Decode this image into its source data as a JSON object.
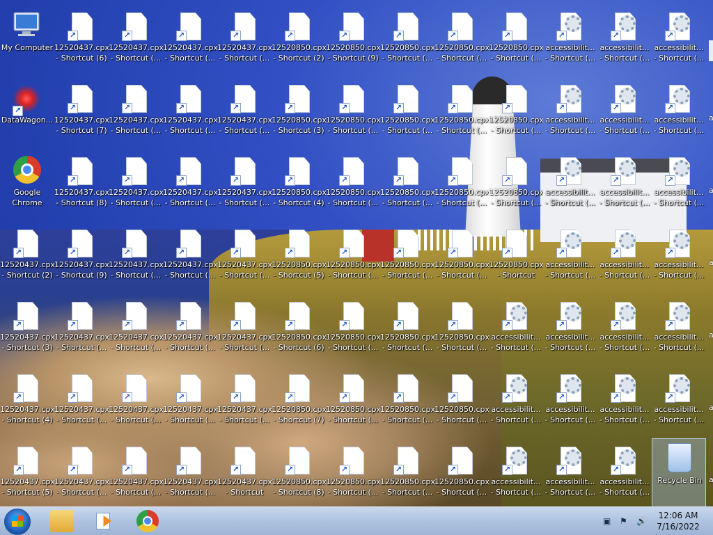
{
  "desktop": {
    "columns": [
      {
        "items": [
          {
            "kind": "computer",
            "l1": "My Computer",
            "l2": ""
          },
          {
            "kind": "datawagon",
            "l1": "DataWagon...",
            "l2": ""
          },
          {
            "kind": "chrome",
            "l1": "Google",
            "l2": "Chrome"
          },
          {
            "kind": "doc",
            "l1": "12520437.cpx",
            "l2": "- Shortcut (2)"
          },
          {
            "kind": "doc",
            "l1": "12520437.cpx",
            "l2": "- Shortcut (3)"
          },
          {
            "kind": "doc",
            "l1": "12520437.cpx",
            "l2": "- Shortcut (4)"
          },
          {
            "kind": "doc",
            "l1": "12520437.cpx",
            "l2": "- Shortcut (5)"
          }
        ]
      },
      {
        "items": [
          {
            "kind": "doc",
            "l1": "12520437.cpx",
            "l2": "- Shortcut (6)"
          },
          {
            "kind": "doc",
            "l1": "12520437.cpx",
            "l2": "- Shortcut (7)"
          },
          {
            "kind": "doc",
            "l1": "12520437.cpx",
            "l2": "- Shortcut (8)"
          },
          {
            "kind": "doc",
            "l1": "12520437.cpx",
            "l2": "- Shortcut (9)"
          },
          {
            "kind": "doc",
            "l1": "12520437.cpx",
            "l2": "- Shortcut (..."
          },
          {
            "kind": "doc",
            "l1": "12520437.cpx",
            "l2": "- Shortcut (..."
          },
          {
            "kind": "doc",
            "l1": "12520437.cpx",
            "l2": "- Shortcut (..."
          }
        ]
      },
      {
        "items": [
          {
            "kind": "doc",
            "l1": "12520437.cpx",
            "l2": "- Shortcut (..."
          },
          {
            "kind": "doc",
            "l1": "12520437.cpx",
            "l2": "- Shortcut (..."
          },
          {
            "kind": "doc",
            "l1": "12520437.cpx",
            "l2": "- Shortcut (..."
          },
          {
            "kind": "doc",
            "l1": "12520437.cpx",
            "l2": "- Shortcut (..."
          },
          {
            "kind": "doc",
            "l1": "12520437.cpx",
            "l2": "- Shortcut (..."
          },
          {
            "kind": "doc",
            "l1": "12520437.cpx",
            "l2": "- Shortcut (..."
          },
          {
            "kind": "doc",
            "l1": "12520437.cpx",
            "l2": "- Shortcut (..."
          }
        ]
      },
      {
        "items": [
          {
            "kind": "doc",
            "l1": "12520437.cpx",
            "l2": "- Shortcut (..."
          },
          {
            "kind": "doc",
            "l1": "12520437.cpx",
            "l2": "- Shortcut (..."
          },
          {
            "kind": "doc",
            "l1": "12520437.cpx",
            "l2": "- Shortcut (..."
          },
          {
            "kind": "doc",
            "l1": "12520437.cpx",
            "l2": "- Shortcut (..."
          },
          {
            "kind": "doc",
            "l1": "12520437.cpx",
            "l2": "- Shortcut (..."
          },
          {
            "kind": "doc",
            "l1": "12520437.cpx",
            "l2": "- Shortcut (..."
          },
          {
            "kind": "doc",
            "l1": "12520437.cpx",
            "l2": "- Shortcut (..."
          }
        ]
      },
      {
        "items": [
          {
            "kind": "doc",
            "l1": "12520437.cpx",
            "l2": "- Shortcut (..."
          },
          {
            "kind": "doc",
            "l1": "12520437.cpx",
            "l2": "- Shortcut (..."
          },
          {
            "kind": "doc",
            "l1": "12520437.cpx",
            "l2": "- Shortcut (..."
          },
          {
            "kind": "doc",
            "l1": "12520437.cpx",
            "l2": "- Shortcut (..."
          },
          {
            "kind": "doc",
            "l1": "12520437.cpx",
            "l2": "- Shortcut (..."
          },
          {
            "kind": "doc",
            "l1": "12520437.cpx",
            "l2": "- Shortcut (..."
          },
          {
            "kind": "doc",
            "l1": "12520437.cpx",
            "l2": "- Shortcut"
          }
        ]
      },
      {
        "items": [
          {
            "kind": "doc",
            "l1": "12520850.cpx",
            "l2": "- Shortcut (2)"
          },
          {
            "kind": "doc",
            "l1": "12520850.cpx",
            "l2": "- Shortcut (3)"
          },
          {
            "kind": "doc",
            "l1": "12520850.cpx",
            "l2": "- Shortcut (4)"
          },
          {
            "kind": "doc",
            "l1": "12520850.cpx",
            "l2": "- Shortcut (5)"
          },
          {
            "kind": "doc",
            "l1": "12520850.cpx",
            "l2": "- Shortcut (6)"
          },
          {
            "kind": "doc",
            "l1": "12520850.cpx",
            "l2": "- Shortcut (7)"
          },
          {
            "kind": "doc",
            "l1": "12520850.cpx",
            "l2": "- Shortcut (8)"
          }
        ]
      },
      {
        "items": [
          {
            "kind": "doc",
            "l1": "12520850.cpx",
            "l2": "- Shortcut (9)"
          },
          {
            "kind": "doc",
            "l1": "12520850.cpx",
            "l2": "- Shortcut (..."
          },
          {
            "kind": "doc",
            "l1": "12520850.cpx",
            "l2": "- Shortcut (..."
          },
          {
            "kind": "doc",
            "l1": "12520850.cpx",
            "l2": "- Shortcut (..."
          },
          {
            "kind": "doc",
            "l1": "12520850.cpx",
            "l2": "- Shortcut (..."
          },
          {
            "kind": "doc",
            "l1": "12520850.cpx",
            "l2": "- Shortcut (..."
          },
          {
            "kind": "doc",
            "l1": "12520850.cpx",
            "l2": "- Shortcut (..."
          }
        ]
      },
      {
        "items": [
          {
            "kind": "doc",
            "l1": "12520850.cpx",
            "l2": "- Shortcut (..."
          },
          {
            "kind": "doc",
            "l1": "12520850.cpx",
            "l2": "- Shortcut (..."
          },
          {
            "kind": "doc",
            "l1": "12520850.cpx",
            "l2": "- Shortcut (..."
          },
          {
            "kind": "doc",
            "l1": "12520850.cpx",
            "l2": "- Shortcut (..."
          },
          {
            "kind": "doc",
            "l1": "12520850.cpx",
            "l2": "- Shortcut (..."
          },
          {
            "kind": "doc",
            "l1": "12520850.cpx",
            "l2": "- Shortcut (..."
          },
          {
            "kind": "doc",
            "l1": "12520850.cpx",
            "l2": "- Shortcut (..."
          }
        ]
      },
      {
        "items": [
          {
            "kind": "doc",
            "l1": "12520850.cpx",
            "l2": "- Shortcut (..."
          },
          {
            "kind": "doc",
            "l1": "12520850.cpx",
            "l2": "- Shortcut (..."
          },
          {
            "kind": "doc",
            "l1": "12520850.cpx",
            "l2": "- Shortcut (..."
          },
          {
            "kind": "doc",
            "l1": "12520850.cpx",
            "l2": "- Shortcut (..."
          },
          {
            "kind": "doc",
            "l1": "12520850.cpx",
            "l2": "- Shortcut (..."
          },
          {
            "kind": "doc",
            "l1": "12520850.cpx",
            "l2": "- Shortcut (..."
          },
          {
            "kind": "doc",
            "l1": "12520850.cpx",
            "l2": "- Shortcut (..."
          }
        ]
      },
      {
        "items": [
          {
            "kind": "doc",
            "l1": "12520850.cpx",
            "l2": "- Shortcut (..."
          },
          {
            "kind": "doc",
            "l1": "12520850.cpx",
            "l2": "- Shortcut (..."
          },
          {
            "kind": "doc",
            "l1": "12520850.cpx",
            "l2": "- Shortcut (..."
          },
          {
            "kind": "doc",
            "l1": "12520850.cpx",
            "l2": "- Shortcut"
          },
          {
            "kind": "gear",
            "l1": "accessibilit...",
            "l2": "- Shortcut (..."
          },
          {
            "kind": "gear",
            "l1": "accessibilit...",
            "l2": "- Shortcut (..."
          },
          {
            "kind": "gear",
            "l1": "accessibilit...",
            "l2": "- Shortcut (..."
          }
        ]
      },
      {
        "items": [
          {
            "kind": "gear",
            "l1": "accessibilit...",
            "l2": "- Shortcut (..."
          },
          {
            "kind": "gear",
            "l1": "accessibilit...",
            "l2": "- Shortcut (..."
          },
          {
            "kind": "gear",
            "l1": "accessibilit...",
            "l2": "- Shortcut (..."
          },
          {
            "kind": "gear",
            "l1": "accessibilit...",
            "l2": "- Shortcut (..."
          },
          {
            "kind": "gear",
            "l1": "accessibilit...",
            "l2": "- Shortcut (..."
          },
          {
            "kind": "gear",
            "l1": "accessibilit...",
            "l2": "- Shortcut (..."
          },
          {
            "kind": "gear",
            "l1": "accessibilit...",
            "l2": "- Shortcut (..."
          }
        ]
      },
      {
        "items": [
          {
            "kind": "gear",
            "l1": "accessibilit...",
            "l2": "- Shortcut (..."
          },
          {
            "kind": "gear",
            "l1": "accessibilit...",
            "l2": "- Shortcut (..."
          },
          {
            "kind": "gear",
            "l1": "accessibilit...",
            "l2": "- Shortcut (..."
          },
          {
            "kind": "gear",
            "l1": "accessibilit...",
            "l2": "- Shortcut (..."
          },
          {
            "kind": "gear",
            "l1": "accessibilit...",
            "l2": "- Shortcut (..."
          },
          {
            "kind": "gear",
            "l1": "accessibilit...",
            "l2": "- Shortcut (..."
          },
          {
            "kind": "gear",
            "l1": "accessibilit...",
            "l2": "- Shortcut (..."
          }
        ]
      },
      {
        "items": [
          {
            "kind": "gear",
            "l1": "accessibilit...",
            "l2": "- Shortcut (..."
          },
          {
            "kind": "gear",
            "l1": "accessibilit...",
            "l2": "- Shortcut (..."
          },
          {
            "kind": "gear",
            "l1": "accessibilit...",
            "l2": "- Shortcut (..."
          },
          {
            "kind": "gear",
            "l1": "accessibilit...",
            "l2": "- Shortcut (..."
          },
          {
            "kind": "gear",
            "l1": "accessibilit...",
            "l2": "- Shortcut (..."
          },
          {
            "kind": "gear",
            "l1": "accessibilit...",
            "l2": "- Shortcut (..."
          },
          {
            "kind": "bin",
            "l1": "Recycle Bin",
            "l2": ""
          }
        ]
      }
    ],
    "edge_glyphs": [
      "a",
      "a",
      "a",
      "a",
      "a",
      "a"
    ]
  },
  "taskbar": {
    "pinned": [
      "start-orb",
      "windows-explorer",
      "media-player",
      "google-chrome"
    ],
    "tray_icons": [
      "network-icon",
      "action-center-icon",
      "volume-icon"
    ],
    "clock_time": "12:06 AM",
    "clock_date": "7/16/2022"
  }
}
